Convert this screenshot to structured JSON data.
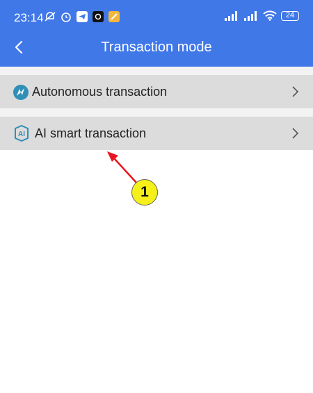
{
  "status_bar": {
    "time": "23:14",
    "battery": "24",
    "icons_left": [
      "mute-bell-icon",
      "alarm-icon",
      "telegram-icon",
      "camera-app-icon",
      "notes-app-icon"
    ],
    "icons_right": [
      "signal-icon",
      "signal-icon",
      "wifi-icon",
      "battery-icon"
    ]
  },
  "header": {
    "title": "Transaction mode",
    "back_icon": "chevron-left-icon",
    "background": "#4178e8"
  },
  "menu": {
    "items": [
      {
        "label": "Autonomous transaction",
        "icon": "autonomous-icon",
        "chevron": "chevron-right-icon"
      },
      {
        "label": "AI smart transaction",
        "icon": "ai-icon",
        "chevron": "chevron-right-icon"
      }
    ]
  },
  "annotation": {
    "callout_number": "1",
    "callout_color": "#f5f019",
    "arrow_color": "#e8141e"
  }
}
